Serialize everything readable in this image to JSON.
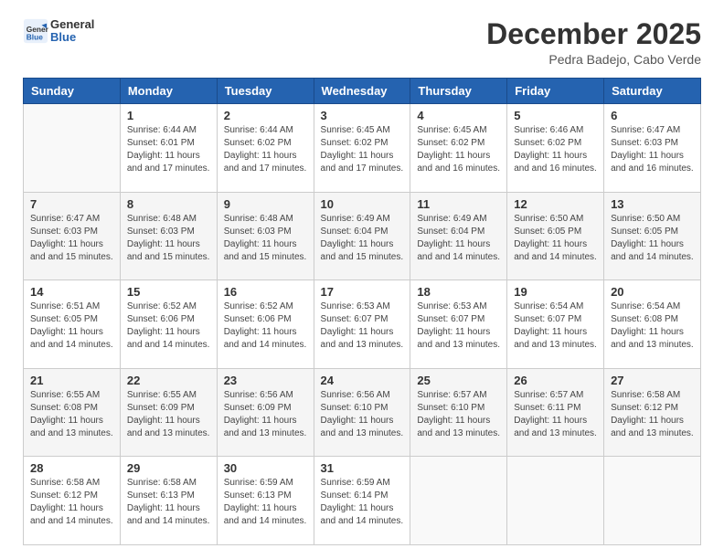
{
  "logo": {
    "general": "General",
    "blue": "Blue"
  },
  "title": "December 2025",
  "location": "Pedra Badejo, Cabo Verde",
  "days_header": [
    "Sunday",
    "Monday",
    "Tuesday",
    "Wednesday",
    "Thursday",
    "Friday",
    "Saturday"
  ],
  "weeks": [
    [
      {
        "day": "",
        "sunrise": "",
        "sunset": "",
        "daylight": ""
      },
      {
        "day": "1",
        "sunrise": "Sunrise: 6:44 AM",
        "sunset": "Sunset: 6:01 PM",
        "daylight": "Daylight: 11 hours and 17 minutes."
      },
      {
        "day": "2",
        "sunrise": "Sunrise: 6:44 AM",
        "sunset": "Sunset: 6:02 PM",
        "daylight": "Daylight: 11 hours and 17 minutes."
      },
      {
        "day": "3",
        "sunrise": "Sunrise: 6:45 AM",
        "sunset": "Sunset: 6:02 PM",
        "daylight": "Daylight: 11 hours and 17 minutes."
      },
      {
        "day": "4",
        "sunrise": "Sunrise: 6:45 AM",
        "sunset": "Sunset: 6:02 PM",
        "daylight": "Daylight: 11 hours and 16 minutes."
      },
      {
        "day": "5",
        "sunrise": "Sunrise: 6:46 AM",
        "sunset": "Sunset: 6:02 PM",
        "daylight": "Daylight: 11 hours and 16 minutes."
      },
      {
        "day": "6",
        "sunrise": "Sunrise: 6:47 AM",
        "sunset": "Sunset: 6:03 PM",
        "daylight": "Daylight: 11 hours and 16 minutes."
      }
    ],
    [
      {
        "day": "7",
        "sunrise": "Sunrise: 6:47 AM",
        "sunset": "Sunset: 6:03 PM",
        "daylight": "Daylight: 11 hours and 15 minutes."
      },
      {
        "day": "8",
        "sunrise": "Sunrise: 6:48 AM",
        "sunset": "Sunset: 6:03 PM",
        "daylight": "Daylight: 11 hours and 15 minutes."
      },
      {
        "day": "9",
        "sunrise": "Sunrise: 6:48 AM",
        "sunset": "Sunset: 6:03 PM",
        "daylight": "Daylight: 11 hours and 15 minutes."
      },
      {
        "day": "10",
        "sunrise": "Sunrise: 6:49 AM",
        "sunset": "Sunset: 6:04 PM",
        "daylight": "Daylight: 11 hours and 15 minutes."
      },
      {
        "day": "11",
        "sunrise": "Sunrise: 6:49 AM",
        "sunset": "Sunset: 6:04 PM",
        "daylight": "Daylight: 11 hours and 14 minutes."
      },
      {
        "day": "12",
        "sunrise": "Sunrise: 6:50 AM",
        "sunset": "Sunset: 6:05 PM",
        "daylight": "Daylight: 11 hours and 14 minutes."
      },
      {
        "day": "13",
        "sunrise": "Sunrise: 6:50 AM",
        "sunset": "Sunset: 6:05 PM",
        "daylight": "Daylight: 11 hours and 14 minutes."
      }
    ],
    [
      {
        "day": "14",
        "sunrise": "Sunrise: 6:51 AM",
        "sunset": "Sunset: 6:05 PM",
        "daylight": "Daylight: 11 hours and 14 minutes."
      },
      {
        "day": "15",
        "sunrise": "Sunrise: 6:52 AM",
        "sunset": "Sunset: 6:06 PM",
        "daylight": "Daylight: 11 hours and 14 minutes."
      },
      {
        "day": "16",
        "sunrise": "Sunrise: 6:52 AM",
        "sunset": "Sunset: 6:06 PM",
        "daylight": "Daylight: 11 hours and 14 minutes."
      },
      {
        "day": "17",
        "sunrise": "Sunrise: 6:53 AM",
        "sunset": "Sunset: 6:07 PM",
        "daylight": "Daylight: 11 hours and 13 minutes."
      },
      {
        "day": "18",
        "sunrise": "Sunrise: 6:53 AM",
        "sunset": "Sunset: 6:07 PM",
        "daylight": "Daylight: 11 hours and 13 minutes."
      },
      {
        "day": "19",
        "sunrise": "Sunrise: 6:54 AM",
        "sunset": "Sunset: 6:07 PM",
        "daylight": "Daylight: 11 hours and 13 minutes."
      },
      {
        "day": "20",
        "sunrise": "Sunrise: 6:54 AM",
        "sunset": "Sunset: 6:08 PM",
        "daylight": "Daylight: 11 hours and 13 minutes."
      }
    ],
    [
      {
        "day": "21",
        "sunrise": "Sunrise: 6:55 AM",
        "sunset": "Sunset: 6:08 PM",
        "daylight": "Daylight: 11 hours and 13 minutes."
      },
      {
        "day": "22",
        "sunrise": "Sunrise: 6:55 AM",
        "sunset": "Sunset: 6:09 PM",
        "daylight": "Daylight: 11 hours and 13 minutes."
      },
      {
        "day": "23",
        "sunrise": "Sunrise: 6:56 AM",
        "sunset": "Sunset: 6:09 PM",
        "daylight": "Daylight: 11 hours and 13 minutes."
      },
      {
        "day": "24",
        "sunrise": "Sunrise: 6:56 AM",
        "sunset": "Sunset: 6:10 PM",
        "daylight": "Daylight: 11 hours and 13 minutes."
      },
      {
        "day": "25",
        "sunrise": "Sunrise: 6:57 AM",
        "sunset": "Sunset: 6:10 PM",
        "daylight": "Daylight: 11 hours and 13 minutes."
      },
      {
        "day": "26",
        "sunrise": "Sunrise: 6:57 AM",
        "sunset": "Sunset: 6:11 PM",
        "daylight": "Daylight: 11 hours and 13 minutes."
      },
      {
        "day": "27",
        "sunrise": "Sunrise: 6:58 AM",
        "sunset": "Sunset: 6:12 PM",
        "daylight": "Daylight: 11 hours and 13 minutes."
      }
    ],
    [
      {
        "day": "28",
        "sunrise": "Sunrise: 6:58 AM",
        "sunset": "Sunset: 6:12 PM",
        "daylight": "Daylight: 11 hours and 14 minutes."
      },
      {
        "day": "29",
        "sunrise": "Sunrise: 6:58 AM",
        "sunset": "Sunset: 6:13 PM",
        "daylight": "Daylight: 11 hours and 14 minutes."
      },
      {
        "day": "30",
        "sunrise": "Sunrise: 6:59 AM",
        "sunset": "Sunset: 6:13 PM",
        "daylight": "Daylight: 11 hours and 14 minutes."
      },
      {
        "day": "31",
        "sunrise": "Sunrise: 6:59 AM",
        "sunset": "Sunset: 6:14 PM",
        "daylight": "Daylight: 11 hours and 14 minutes."
      },
      {
        "day": "",
        "sunrise": "",
        "sunset": "",
        "daylight": ""
      },
      {
        "day": "",
        "sunrise": "",
        "sunset": "",
        "daylight": ""
      },
      {
        "day": "",
        "sunrise": "",
        "sunset": "",
        "daylight": ""
      }
    ]
  ]
}
